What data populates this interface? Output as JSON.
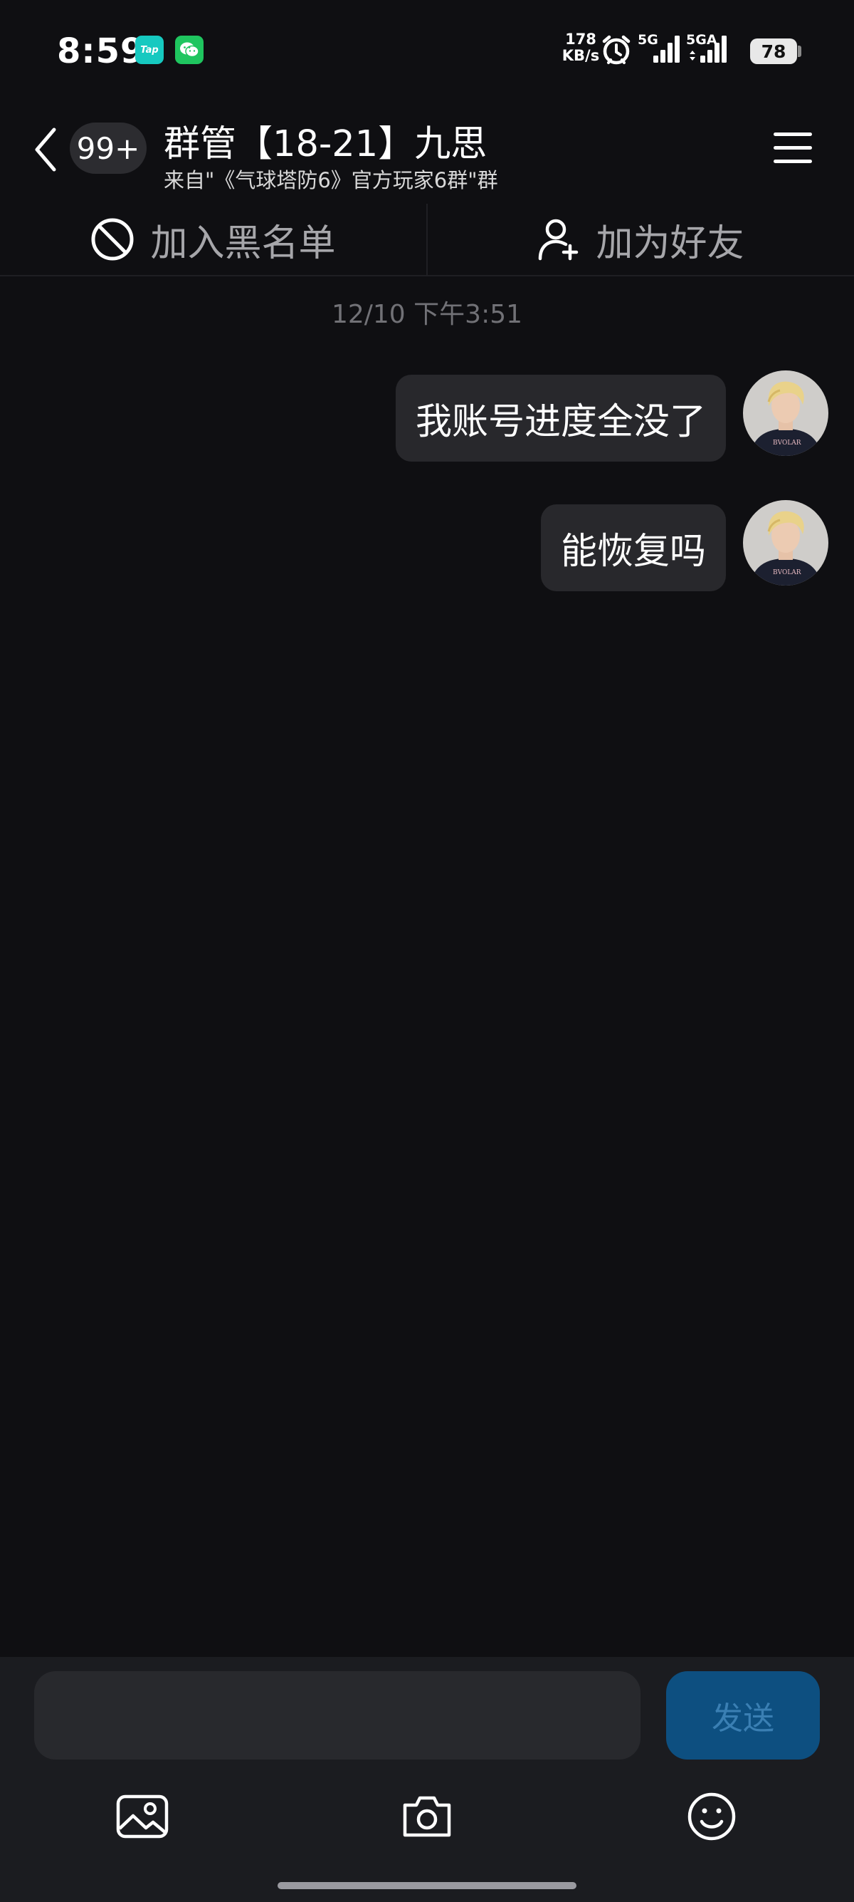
{
  "status_bar": {
    "time": "8:59",
    "tap_badge": "Tap",
    "net_speed_value": "178",
    "net_speed_unit": "KB/s",
    "sim1_label": "5G",
    "sim2_label": "5GA",
    "battery": "78"
  },
  "header": {
    "unread_count": "99+",
    "title": "群管【18-21】九思",
    "subtitle": "来自\"《气球塔防6》官方玩家6群\"群"
  },
  "actions": {
    "block_label": "加入黑名单",
    "add_friend_label": "加为好友"
  },
  "conversation": {
    "timestamp": "12/10 下午3:51",
    "messages": [
      {
        "text": "我账号进度全没了",
        "sender": "me"
      },
      {
        "text": "能恢复吗",
        "sender": "me"
      }
    ]
  },
  "composer": {
    "placeholder": "",
    "send_label": "发送"
  },
  "colors": {
    "background": "#0f0f12",
    "bubble": "#28282c",
    "send_button": "#0d4f80",
    "send_text": "#3a7fb3"
  }
}
